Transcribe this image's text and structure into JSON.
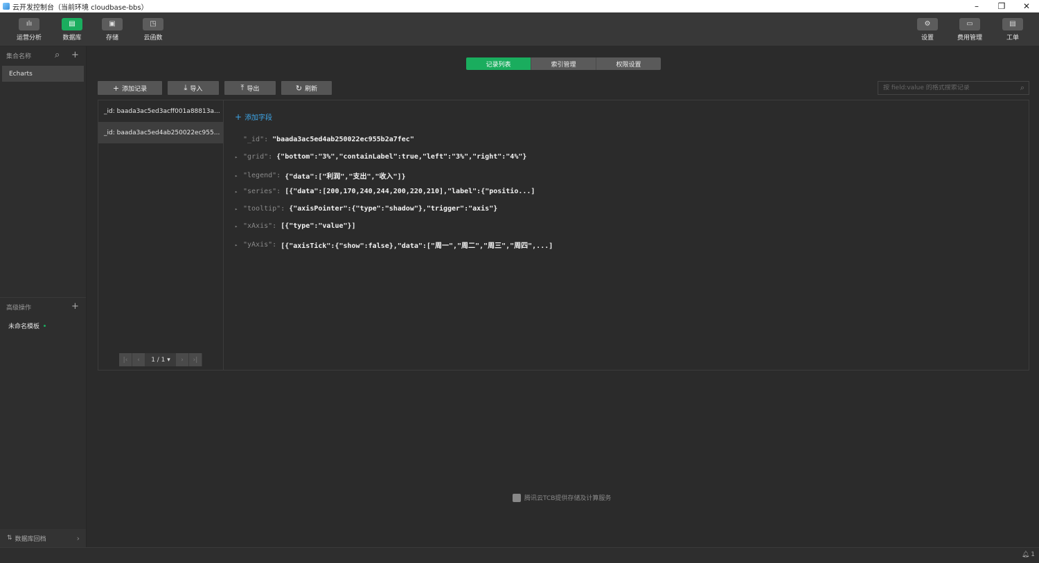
{
  "window": {
    "title": "云开发控制台（当前环境 cloudbase-bbs）",
    "controls": {
      "minimize": "–",
      "restore": "❐",
      "close": "✕"
    }
  },
  "toolbar": {
    "left": [
      {
        "label": "运营分析",
        "icon": "chart-icon",
        "glyph": "ılı"
      },
      {
        "label": "数据库",
        "icon": "database-icon",
        "glyph": "▤",
        "active": true
      },
      {
        "label": "存储",
        "icon": "storage-icon",
        "glyph": "▣"
      },
      {
        "label": "云函数",
        "icon": "function-icon",
        "glyph": "◳"
      }
    ],
    "right": [
      {
        "label": "设置",
        "icon": "gear-icon",
        "glyph": "⚙"
      },
      {
        "label": "费用管理",
        "icon": "billing-icon",
        "glyph": "▭"
      },
      {
        "label": "工单",
        "icon": "ticket-icon",
        "glyph": "▤"
      }
    ]
  },
  "sidebar": {
    "collections_title": "集合名称",
    "search_glyph": "⌕",
    "add_glyph": "+",
    "collections": [
      "Echarts"
    ],
    "advanced_title": "高级操作",
    "templates": [
      "未命名模板"
    ],
    "backup_label": "数据库回档",
    "backup_glyph": "⇅",
    "chevron": "›"
  },
  "tabs": [
    {
      "label": "记录列表",
      "active": true
    },
    {
      "label": "索引管理"
    },
    {
      "label": "权限设置"
    }
  ],
  "actions": [
    {
      "label": "添加记录",
      "glyph": "+",
      "icon": "plus-icon"
    },
    {
      "label": "导入",
      "glyph": "⤓",
      "icon": "import-icon"
    },
    {
      "label": "导出",
      "glyph": "⤒",
      "icon": "export-icon"
    },
    {
      "label": "刷新",
      "glyph": "↻",
      "icon": "refresh-icon"
    }
  ],
  "search": {
    "placeholder": "按 field:value 的格式搜索记录",
    "glyph": "⌕"
  },
  "records": [
    "_id: baada3ac5ed3acff001a88813a...",
    "_id: baada3ac5ed4ab250022ec955..."
  ],
  "pager": {
    "first": "|‹",
    "prev": "‹",
    "page": "1 / 1 ▾",
    "next": "›",
    "last": "›|"
  },
  "document": {
    "add_field": "添加字段",
    "add_glyph": "+",
    "expander": "▸",
    "fields": [
      {
        "key": "\"_id\"",
        "value": "\"baada3ac5ed4ab250022ec955b2a7fec\"",
        "expandable": false
      },
      {
        "key": "\"grid\"",
        "value": "{\"bottom\":\"3%\",\"containLabel\":true,\"left\":\"3%\",\"right\":\"4%\"}",
        "expandable": true
      },
      {
        "key": "\"legend\"",
        "value": "{\"data\":[\"利润\",\"支出\",\"收入\"]}",
        "expandable": true
      },
      {
        "key": "\"series\"",
        "value": "[{\"data\":[200,170,240,244,200,220,210],\"label\":{\"positio...]",
        "expandable": true
      },
      {
        "key": "\"tooltip\"",
        "value": "{\"axisPointer\":{\"type\":\"shadow\"},\"trigger\":\"axis\"}",
        "expandable": true
      },
      {
        "key": "\"xAxis\"",
        "value": "[{\"type\":\"value\"}]",
        "expandable": true
      },
      {
        "key": "\"yAxis\"",
        "value": "[{\"axisTick\":{\"show\":false},\"data\":[\"周一\",\"周二\",\"周三\",\"周四\",...]",
        "expandable": true
      }
    ]
  },
  "footer": {
    "text": "腾讯云TCB提供存储及计算服务"
  },
  "status": {
    "notification_glyph": "🔔︎",
    "notification_count": "1"
  },
  "colors": {
    "accent": "#1aad5e",
    "link": "#3ea6e8",
    "background": "#2b2b2b"
  }
}
